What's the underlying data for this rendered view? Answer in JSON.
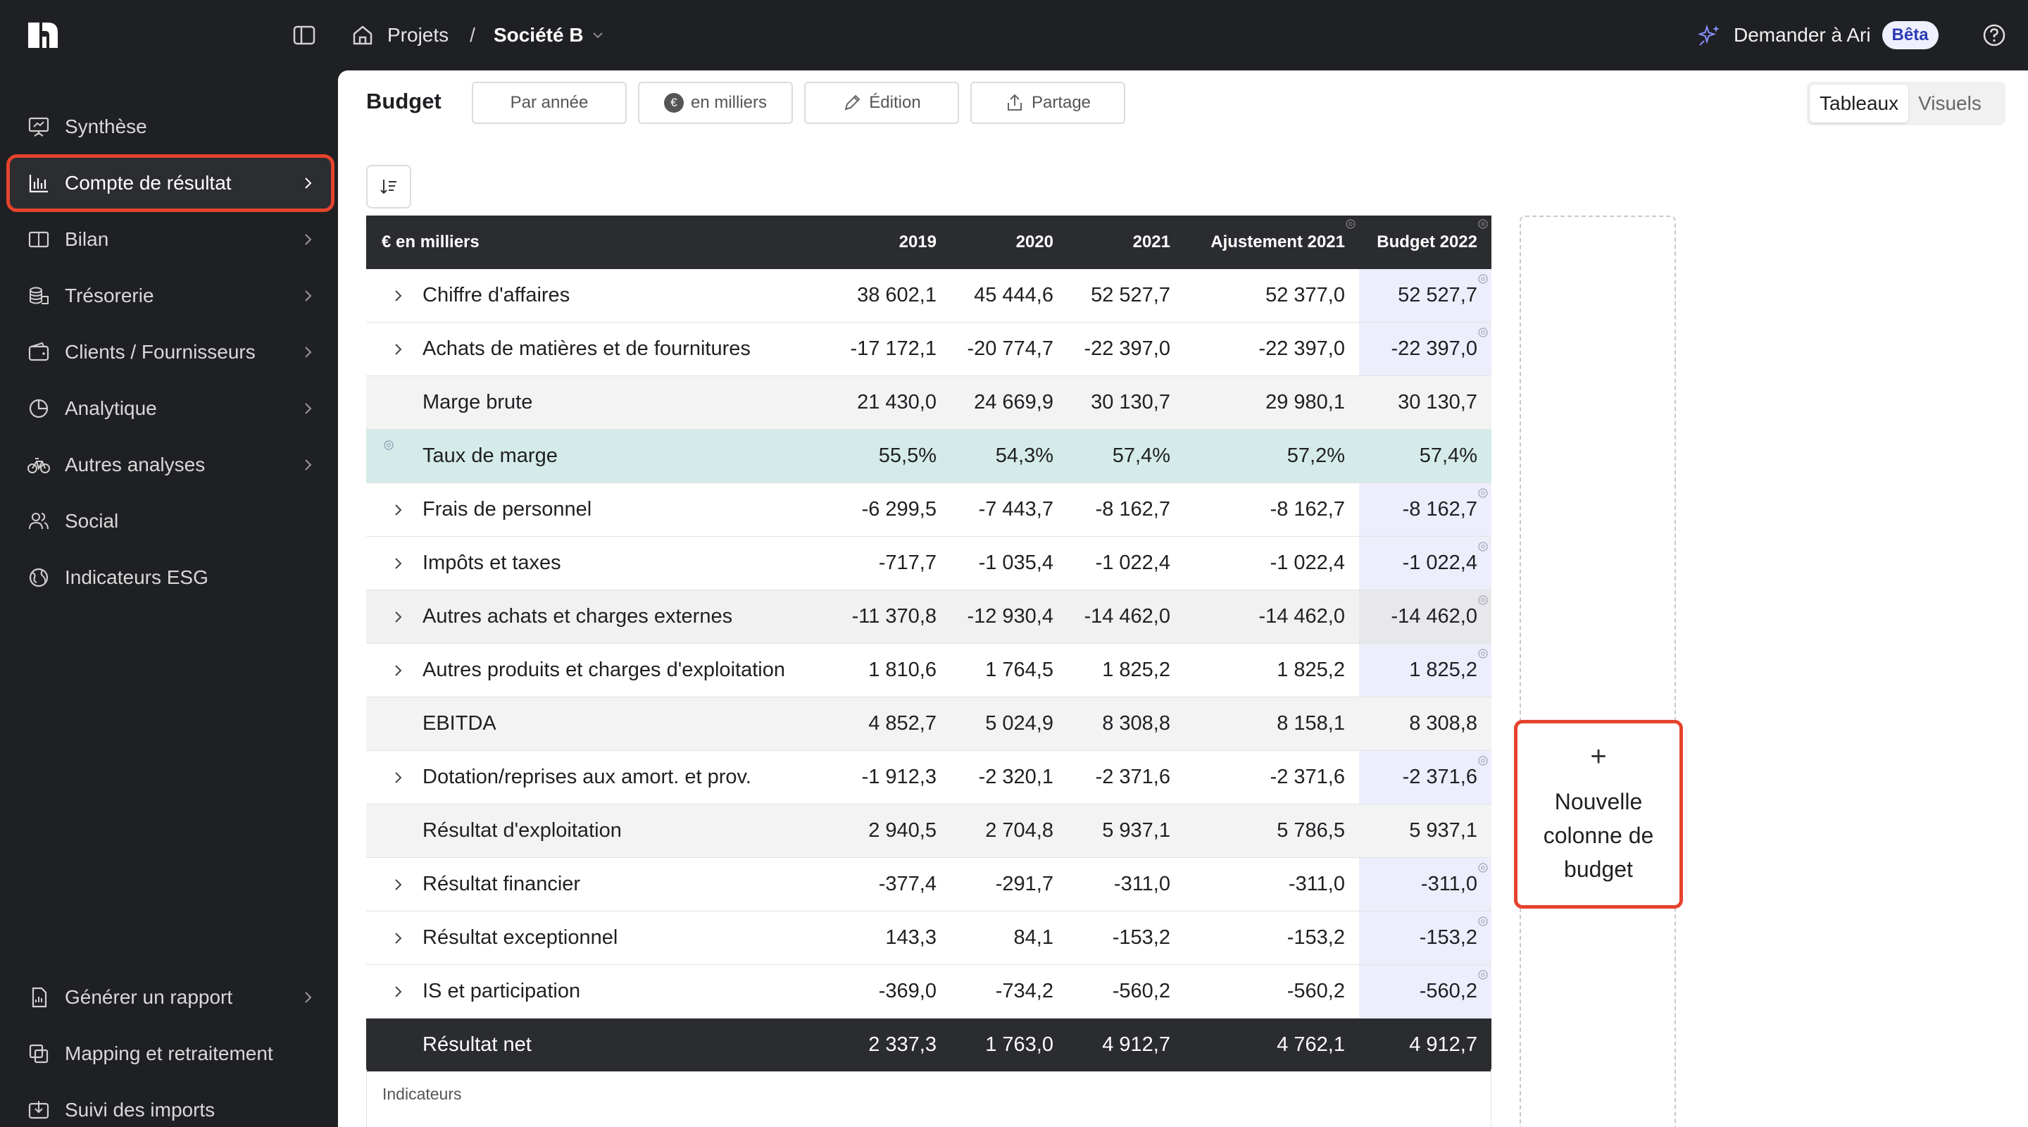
{
  "breadcrumb": {
    "projects": "Projets",
    "separator": "/",
    "current": "Société B"
  },
  "assistant": {
    "label": "Demander à Ari",
    "badge": "Bêta"
  },
  "sidebar": {
    "items": [
      {
        "label": "Synthèse"
      },
      {
        "label": "Compte de résultat"
      },
      {
        "label": "Bilan"
      },
      {
        "label": "Trésorerie"
      },
      {
        "label": "Clients / Fournisseurs"
      },
      {
        "label": "Analytique"
      },
      {
        "label": "Autres analyses"
      },
      {
        "label": "Social"
      },
      {
        "label": "Indicateurs ESG"
      }
    ],
    "bottom": [
      {
        "label": "Générer un rapport"
      },
      {
        "label": "Mapping et retraitement"
      },
      {
        "label": "Suivi des imports"
      }
    ]
  },
  "toolbar": {
    "title": "Budget",
    "by_year": "Par année",
    "currency_icon": "€",
    "unit": "en milliers",
    "edit": "Édition",
    "share": "Partage",
    "view_tables": "Tableaux",
    "view_visuals": "Visuels"
  },
  "table": {
    "columns": [
      "€ en milliers",
      "2019",
      "2020",
      "2021",
      "Ajustement 2021",
      "Budget 2022"
    ],
    "rows": [
      {
        "label": "Chiffre d'affaires",
        "values": [
          "38 602,1",
          "45 444,6",
          "52 527,7",
          "52 377,0",
          "52 527,7"
        ]
      },
      {
        "label": "Achats de matières et de fournitures",
        "values": [
          "-17 172,1",
          "-20 774,7",
          "-22 397,0",
          "-22 397,0",
          "-22 397,0"
        ]
      },
      {
        "label": "Marge brute",
        "values": [
          "21 430,0",
          "24 669,9",
          "30 130,7",
          "29 980,1",
          "30 130,7"
        ]
      },
      {
        "label": "Taux de marge",
        "values": [
          "55,5%",
          "54,3%",
          "57,4%",
          "57,2%",
          "57,4%"
        ]
      },
      {
        "label": "Frais de personnel",
        "values": [
          "-6 299,5",
          "-7 443,7",
          "-8 162,7",
          "-8 162,7",
          "-8 162,7"
        ]
      },
      {
        "label": "Impôts et taxes",
        "values": [
          "-717,7",
          "-1 035,4",
          "-1 022,4",
          "-1 022,4",
          "-1 022,4"
        ]
      },
      {
        "label": "Autres achats et charges externes",
        "values": [
          "-11 370,8",
          "-12 930,4",
          "-14 462,0",
          "-14 462,0",
          "-14 462,0"
        ]
      },
      {
        "label": "Autres produits et charges d'exploitation",
        "values": [
          "1 810,6",
          "1 764,5",
          "1 825,2",
          "1 825,2",
          "1 825,2"
        ]
      },
      {
        "label": "EBITDA",
        "values": [
          "4 852,7",
          "5 024,9",
          "8 308,8",
          "8 158,1",
          "8 308,8"
        ]
      },
      {
        "label": "Dotation/reprises aux amort. et prov.",
        "values": [
          "-1 912,3",
          "-2 320,1",
          "-2 371,6",
          "-2 371,6",
          "-2 371,6"
        ]
      },
      {
        "label": "Résultat d'exploitation",
        "values": [
          "2 940,5",
          "2 704,8",
          "5 937,1",
          "5 786,5",
          "5 937,1"
        ]
      },
      {
        "label": "Résultat financier",
        "values": [
          "-377,4",
          "-291,7",
          "-311,0",
          "-311,0",
          "-311,0"
        ]
      },
      {
        "label": "Résultat exceptionnel",
        "values": [
          "143,3",
          "84,1",
          "-153,2",
          "-153,2",
          "-153,2"
        ]
      },
      {
        "label": "IS et participation",
        "values": [
          "-369,0",
          "-734,2",
          "-560,2",
          "-560,2",
          "-560,2"
        ]
      },
      {
        "label": "Résultat net",
        "values": [
          "2 337,3",
          "1 763,0",
          "4 912,7",
          "4 762,1",
          "4 912,7"
        ]
      }
    ],
    "indicators_label": "Indicateurs"
  },
  "new_column": {
    "plus": "+",
    "line1": "Nouvelle",
    "line2": "colonne de",
    "line3": "budget"
  },
  "colors": {
    "accent_highlight": "#e5432d",
    "dark_bg": "#1f2023",
    "rate_row": "#d5ebe9",
    "budget_col": "#eceefb"
  }
}
